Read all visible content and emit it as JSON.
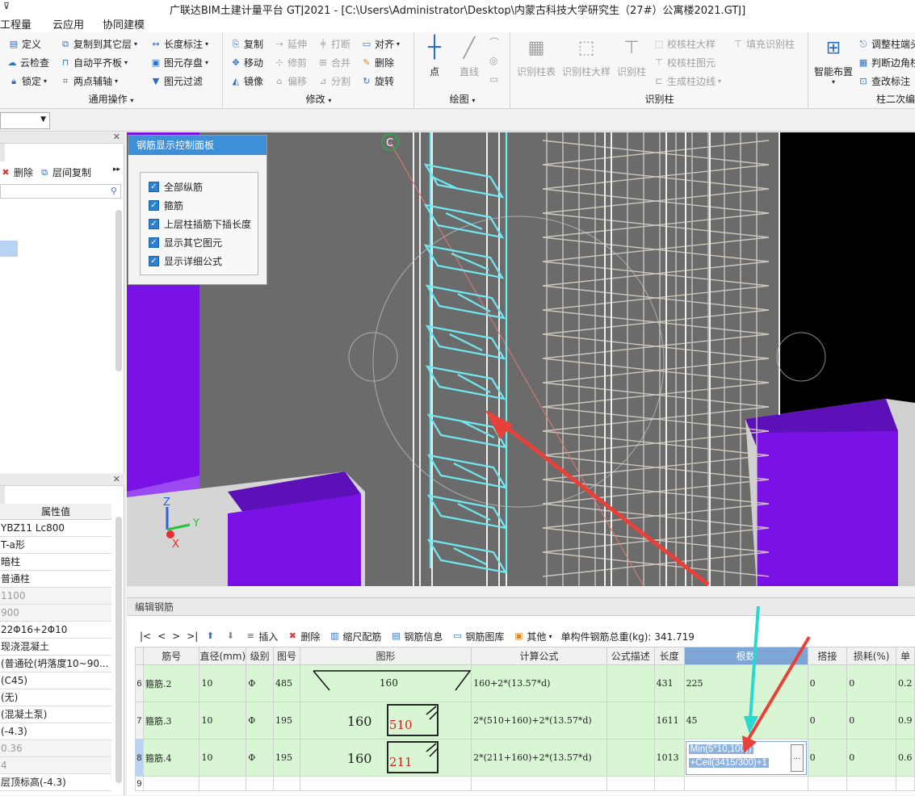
{
  "window": {
    "title": "广联达BIM土建计量平台 GTJ2021 - [C:\\Users\\Administrator\\Desktop\\内蒙古科技大学研究生（27#）公寓楼2021.GTJ]"
  },
  "menu": [
    "工程量",
    "云应用",
    "协同建模"
  ],
  "ribbon": {
    "general": {
      "title": "通用操作",
      "items": [
        "定义",
        "复制到其它层",
        "长度标注",
        "云检查",
        "自动平齐板",
        "图元存盘",
        "锁定",
        "两点辅轴",
        "图元过滤"
      ]
    },
    "modify": {
      "title": "修改",
      "items": [
        "复制",
        "延伸",
        "打断",
        "对齐",
        "移动",
        "修剪",
        "合并",
        "删除",
        "镜像",
        "偏移",
        "分割",
        "旋转"
      ]
    },
    "draw": {
      "title": "绘图",
      "items": [
        "点",
        "直线"
      ]
    },
    "identify": {
      "title": "识别柱",
      "items": [
        "识别柱表",
        "识别柱大样",
        "识别柱",
        "校核柱大样",
        "校核柱图元",
        "生成柱边线",
        "填充识别柱"
      ]
    },
    "col2": {
      "title": "柱二次编",
      "items": [
        "智能布置",
        "调整柱端头",
        "判断边角柱",
        "查改标注"
      ]
    }
  },
  "left_panel": {
    "toolbar": [
      "删除",
      "层间复制"
    ],
    "prop_header": "属性值",
    "props": [
      "YBZ11 Lc800",
      "T-a形",
      "暗柱",
      "普通柱",
      "1100",
      "900",
      "22Φ16+2Φ10",
      "现浇混凝土",
      "(普通砼(坍落度10~90...",
      "(C45)",
      "(无)",
      "(混凝土泵)",
      "(-4.3)",
      "0.36",
      "4",
      "层顶标高(-4.3)"
    ]
  },
  "control_panel": {
    "title": "钢筋显示控制面板",
    "options": [
      "全部纵筋",
      "箍筋",
      "上层柱插筋下插长度",
      "显示其它图元",
      "显示详细公式"
    ]
  },
  "viewport": {
    "axis_label": "C",
    "axes": [
      "Z",
      "Y",
      "X"
    ]
  },
  "edit_panel": {
    "title": "编辑钢筋",
    "nav": [
      "|<",
      "<",
      ">",
      ">|"
    ],
    "toolbar": [
      "插入",
      "删除",
      "缩尺配筋",
      "钢筋信息",
      "钢筋图库",
      "其他"
    ],
    "total_weight": "单构件钢筋总重(kg): 341.719",
    "columns": [
      "筋号",
      "直径(mm)",
      "级别",
      "图号",
      "图形",
      "计算公式",
      "公式描述",
      "长度",
      "根数",
      "搭接",
      "损耗(%)",
      "单"
    ],
    "rows": [
      {
        "rownum": "6",
        "name": "箍筋.2",
        "dia": "10",
        "grade": "Φ",
        "fig": "485",
        "shape_val": "160",
        "shape_red": "",
        "formula": "160+2*(13.57*d)",
        "desc": "",
        "length": "431",
        "count": "225",
        "lap": "0",
        "loss": "0",
        "unit": "0.2"
      },
      {
        "rownum": "7",
        "name": "箍筋.3",
        "dia": "10",
        "grade": "Φ",
        "fig": "195",
        "shape_val": "160",
        "shape_red": "510",
        "formula": "2*(510+160)+2*(13.57*d)",
        "desc": "",
        "length": "1611",
        "count": "45",
        "lap": "0",
        "loss": "0",
        "unit": "0.9"
      },
      {
        "rownum": "8",
        "name": "箍筋.4",
        "dia": "10",
        "grade": "Φ",
        "fig": "195",
        "shape_val": "160",
        "shape_red": "211",
        "formula": "2*(211+160)+2*(13.57*d)",
        "desc": "",
        "length": "1013",
        "count_line1": "Min(5*10,100))",
        "count_line2": "+Ceil(3415/300)+1",
        "count_btn": "...",
        "lap": "0",
        "loss": "0",
        "unit": "0.6"
      },
      {
        "rownum": "9"
      }
    ]
  },
  "colors": {
    "accent": "#3d8fd8",
    "row_green": "#d8f5d4",
    "rebar_cyan": "#6fe8f0",
    "column_purple": "#7a12e6",
    "arrow_red": "#e8413a"
  }
}
